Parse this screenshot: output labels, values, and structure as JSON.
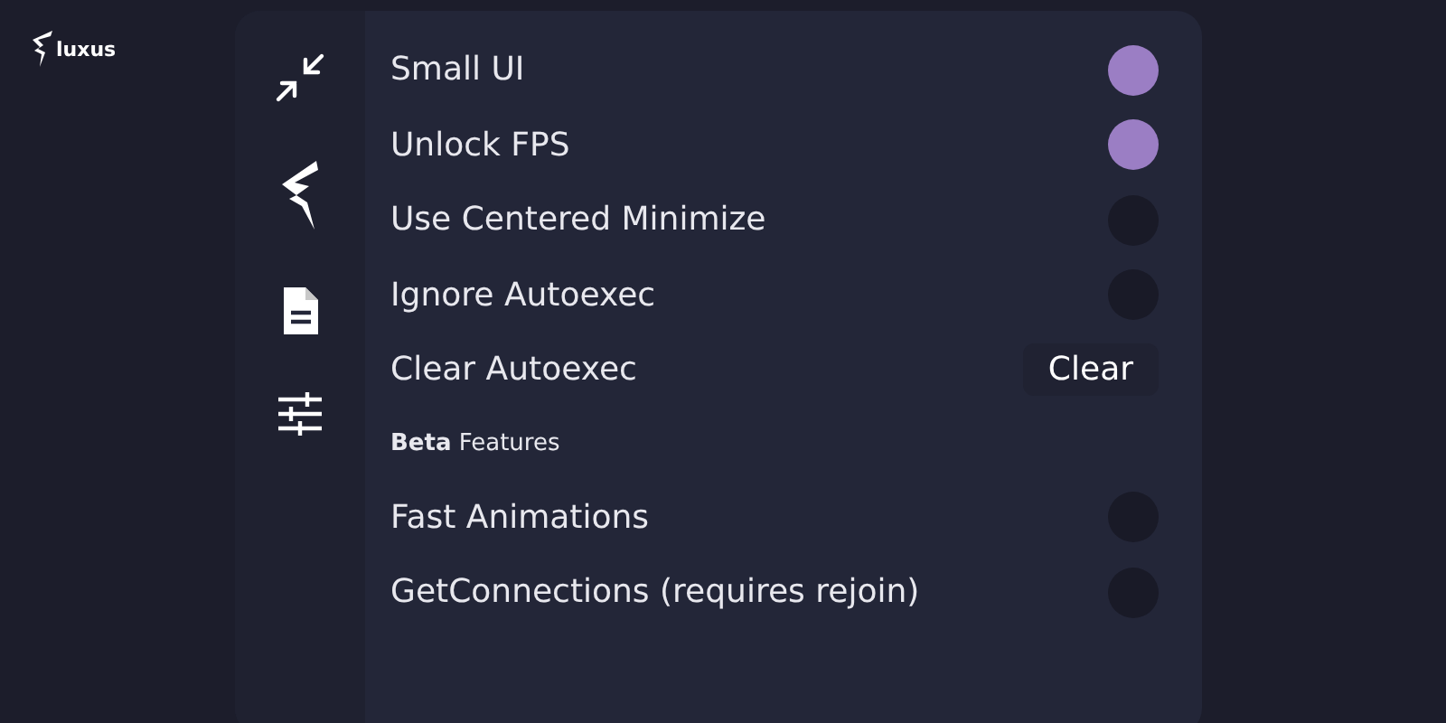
{
  "logo": {
    "text": "luxus"
  },
  "sidebar": {
    "items": [
      {
        "kind": "compress"
      },
      {
        "kind": "logo"
      },
      {
        "kind": "document"
      },
      {
        "kind": "sliders"
      }
    ]
  },
  "settings": [
    {
      "kind": "toggle",
      "label": "Small UI",
      "on": true
    },
    {
      "kind": "toggle",
      "label": "Unlock FPS",
      "on": true
    },
    {
      "kind": "toggle",
      "label": "Use Centered Minimize",
      "on": false
    },
    {
      "kind": "toggle",
      "label": "Ignore Autoexec",
      "on": false
    },
    {
      "kind": "button",
      "label": "Clear Autoexec",
      "button": "Clear"
    },
    {
      "kind": "heading",
      "label": "**Beta** Features"
    },
    {
      "kind": "toggle",
      "label": "Fast Animations",
      "on": false
    },
    {
      "kind": "toggle",
      "label": "GetConnections (requires rejoin)",
      "on": false
    }
  ]
}
